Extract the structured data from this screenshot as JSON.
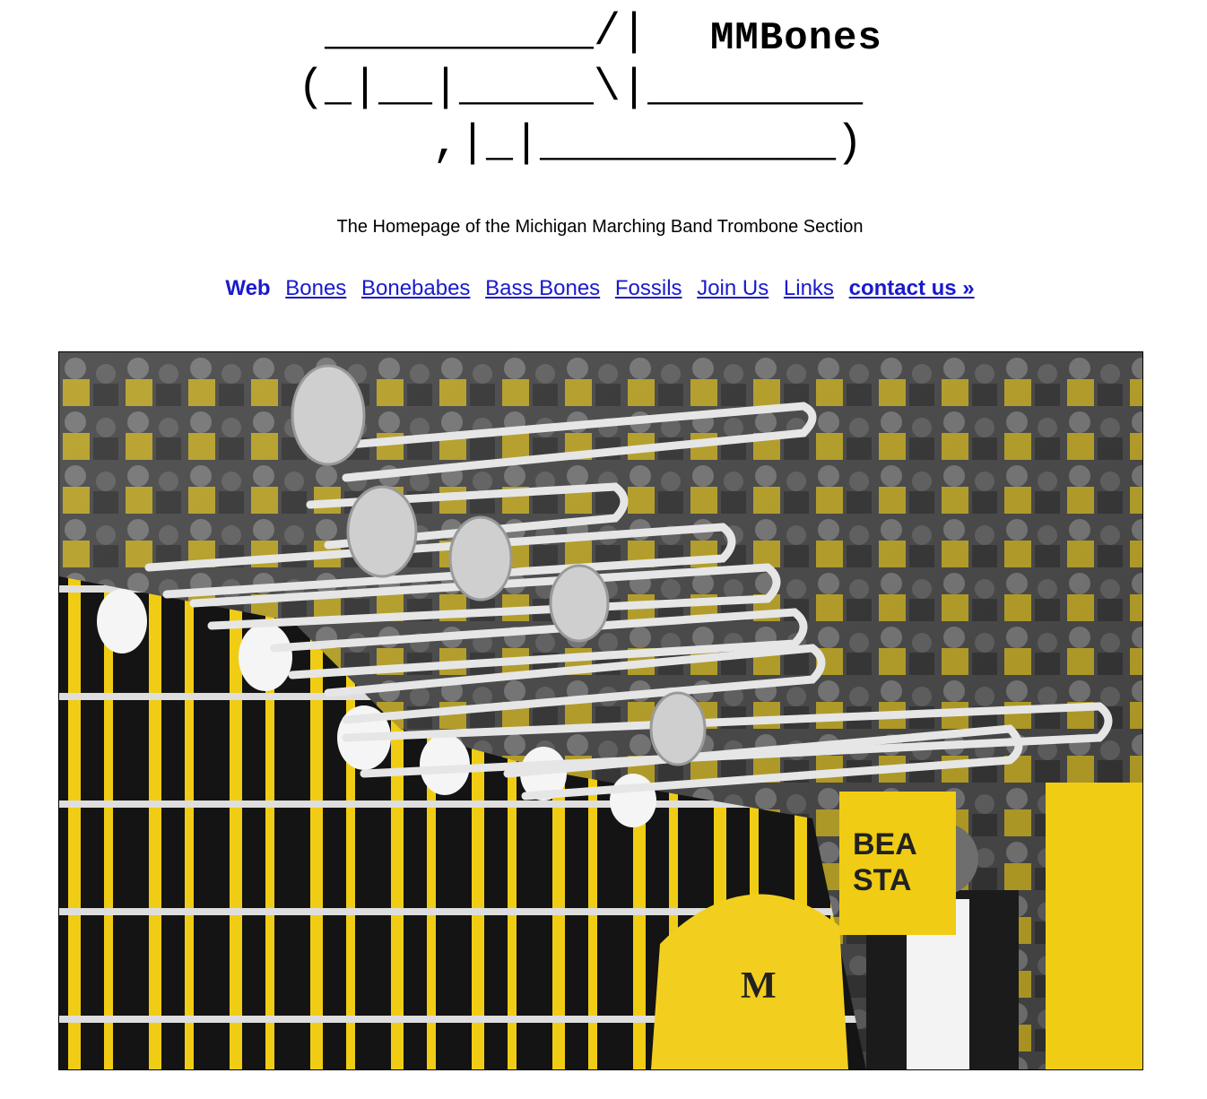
{
  "logo": {
    "ascii_lines": [
      " __________/|   ",
      "(_|__|_____\\|________",
      "     ,|_|___________)"
    ],
    "title": "MMBones"
  },
  "tagline": "The Homepage of the Michigan Marching Band Trombone Section",
  "nav": {
    "current": "Web",
    "links": [
      "Bones",
      "Bonebabes",
      "Bass Bones",
      "Fossils",
      "Join Us",
      "Links"
    ],
    "contact": "contact us »"
  },
  "hero": {
    "description_icon": "trombone-section-photo",
    "colors": {
      "maize": "#f2cf1f",
      "black": "#111111",
      "silver": "#d9d9d9"
    }
  }
}
